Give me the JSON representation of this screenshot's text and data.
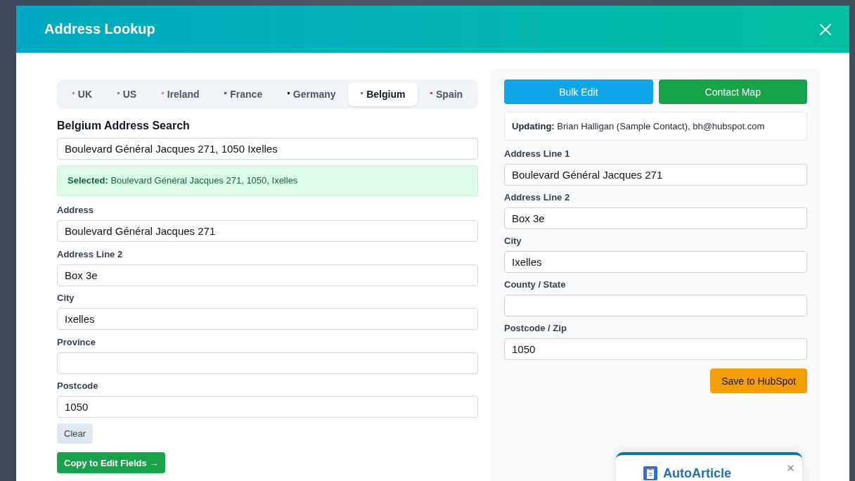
{
  "window": {
    "title": "Address Lookup"
  },
  "tabs": [
    {
      "label": "UK",
      "color": "#e07b8e",
      "selected": false
    },
    {
      "label": "US",
      "color": "#7a7f9a",
      "selected": false
    },
    {
      "label": "Ireland",
      "color": "#c9a040",
      "selected": false
    },
    {
      "label": "France",
      "color": "#3355c0",
      "selected": false
    },
    {
      "label": "Germany",
      "color": "#222222",
      "selected": false
    },
    {
      "label": "Belgium",
      "color": "#e0521e",
      "selected": true
    },
    {
      "label": "Spain",
      "color": "#e0401e",
      "selected": false
    }
  ],
  "search": {
    "heading": "Belgium Address Search",
    "value": "Boulevard Général Jacques 271, 1050 Ixelles",
    "selected": "**Selected:** Boulevard Général Jacques 271, 1050, Ixelles"
  },
  "address_fields": [
    {
      "label": "Address",
      "value": "Boulevard Général Jacques 271"
    },
    {
      "label": "Address Line 2",
      "value": "Box 3e"
    },
    {
      "label": "City",
      "value": "Ixelles"
    },
    {
      "label": "Province"
    },
    {
      "label": "Postcode",
      "value": "1050"
    }
  ],
  "left_buttons": [
    {
      "label": "Clear",
      "kind": "secondary"
    },
    {
      "label": "Copy to Edit Fields →",
      "kind": "success"
    }
  ],
  "top_buttons": [
    {
      "label": "Bulk Edit",
      "kind": "info"
    },
    {
      "label": "Contact Map",
      "kind": "success"
    }
  ],
  "updating": "**Updating:** Brian Halligan (Sample Contact), bh@hubspot.com",
  "edit_fields": [
    {
      "label": "Address Line 1",
      "value": "Boulevard Général Jacques 271"
    },
    {
      "label": "Address Line 2",
      "value": "Box 3e"
    },
    {
      "label": "City",
      "value": "Ixelles"
    },
    {
      "label": "County / State"
    },
    {
      "label": "Postcode / Zip",
      "value": "1050"
    }
  ],
  "save_button": {
    "label": "Save to HubSpot",
    "kind": "warning"
  },
  "popup": {
    "title": "AutoArticle"
  }
}
